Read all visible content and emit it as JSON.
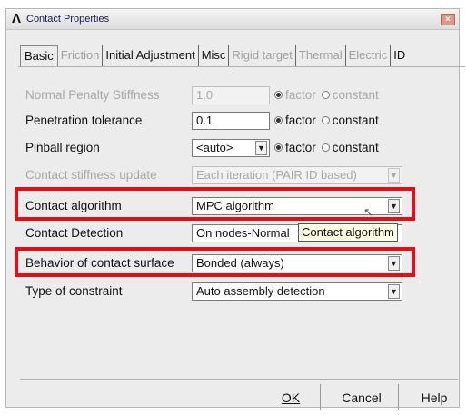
{
  "window": {
    "title": "Contact Properties",
    "logo": "Λ",
    "close_icon": "close-icon"
  },
  "tabs": [
    {
      "label": "Basic",
      "state": "active"
    },
    {
      "label": "Friction",
      "state": "disabled"
    },
    {
      "label": "Initial Adjustment",
      "state": "enabled"
    },
    {
      "label": "Misc",
      "state": "enabled"
    },
    {
      "label": "Rigid target",
      "state": "disabled"
    },
    {
      "label": "Thermal",
      "state": "disabled"
    },
    {
      "label": "Electric",
      "state": "disabled"
    },
    {
      "label": "ID",
      "state": "enabled"
    }
  ],
  "rows": {
    "normal_penalty": {
      "label": "Normal Penalty Stiffness",
      "value": "1.0",
      "opt1": "factor",
      "opt2": "constant",
      "selected": "factor",
      "enabled": false
    },
    "penetration": {
      "label": "Penetration tolerance",
      "value": "0.1",
      "opt1": "factor",
      "opt2": "constant",
      "selected": "factor",
      "enabled": true
    },
    "pinball": {
      "label": "Pinball region",
      "value": "<auto>",
      "opt1": "factor",
      "opt2": "constant",
      "selected": "factor",
      "enabled": true
    },
    "stiffness_update": {
      "label": "Contact stiffness update",
      "value": "Each iteration (PAIR ID based)",
      "enabled": false
    },
    "algorithm": {
      "label": "Contact algorithm",
      "value": "MPC algorithm",
      "enabled": true
    },
    "detection": {
      "label": "Contact Detection",
      "value": "On nodes-Normal",
      "enabled": true
    },
    "behavior": {
      "label": "Behavior of contact surface",
      "value": "Bonded (always)",
      "enabled": true
    },
    "constraint": {
      "label": "Type of constraint",
      "value": "Auto assembly detection",
      "enabled": true
    }
  },
  "tooltip": {
    "text": "Contact algorithm"
  },
  "buttons": {
    "ok": "OK",
    "cancel": "Cancel",
    "help": "Help"
  },
  "colors": {
    "highlight": "#e0101a",
    "dialog_bg": "#ececec",
    "tooltip_bg": "#ffffe6"
  }
}
